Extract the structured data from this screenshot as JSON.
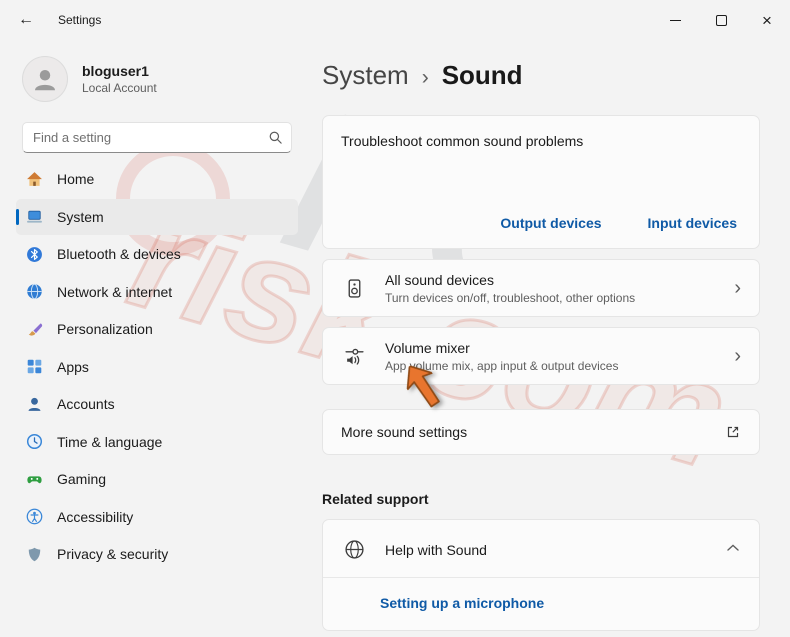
{
  "titlebar": {
    "title": "Settings",
    "back_icon": "←",
    "close_icon": "×"
  },
  "sidebar": {
    "user": {
      "name": "bloguser1",
      "account_type": "Local Account"
    },
    "search": {
      "placeholder": "Find a setting"
    },
    "items": [
      {
        "label": "Home"
      },
      {
        "label": "System"
      },
      {
        "label": "Bluetooth & devices"
      },
      {
        "label": "Network & internet"
      },
      {
        "label": "Personalization"
      },
      {
        "label": "Apps"
      },
      {
        "label": "Accounts"
      },
      {
        "label": "Time & language"
      },
      {
        "label": "Gaming"
      },
      {
        "label": "Accessibility"
      },
      {
        "label": "Privacy & security"
      }
    ],
    "selected_item": "System"
  },
  "main": {
    "breadcrumb": {
      "parent": "System",
      "separator": "›",
      "current": "Sound"
    },
    "troubleshoot": {
      "title": "Troubleshoot common sound problems",
      "links": [
        "Output devices",
        "Input devices"
      ]
    },
    "rows": [
      {
        "title": "All sound devices",
        "subtitle": "Turn devices on/off, troubleshoot, other options",
        "icon": "speaker-icon"
      },
      {
        "title": "Volume mixer",
        "subtitle": "App volume mix, app input & output devices",
        "icon": "volume-mixer-icon"
      }
    ],
    "more_settings": {
      "title": "More sound settings",
      "icon": "external-link-icon"
    },
    "related_heading": "Related support",
    "help": {
      "title": "Help with Sound",
      "icon": "globe-icon",
      "link": "Setting up a microphone"
    }
  },
  "icons": {
    "chevron_right": "›"
  },
  "watermark": {
    "part1": "PC",
    "part2": "risk.com"
  },
  "colors": {
    "accent_link": "#0f5aa6",
    "selection_indicator": "#0067c0",
    "arrow_cursor": "#e8752e"
  }
}
